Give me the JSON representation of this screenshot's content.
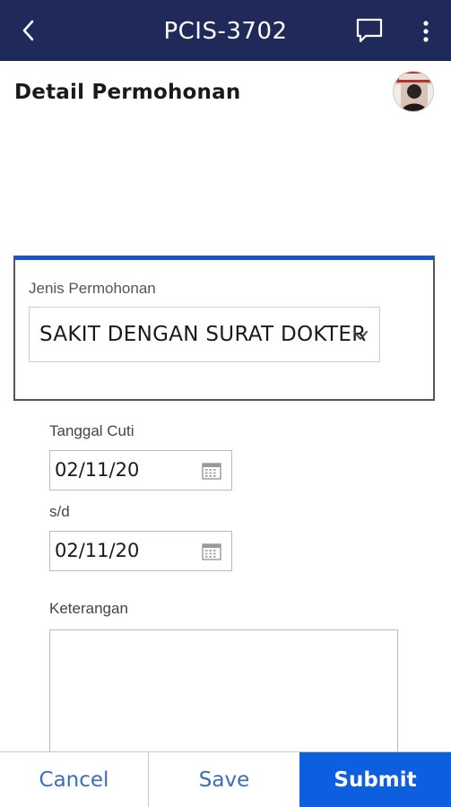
{
  "header": {
    "title": "PCIS-3702",
    "back_icon": "chevron-left-icon",
    "chat_icon": "chat-bubble-icon",
    "more_icon": "more-vertical-icon",
    "background": "#1f2a5a"
  },
  "page": {
    "title": "Detail Permohonan"
  },
  "form": {
    "request_type": {
      "label": "Jenis Permohonan",
      "value": "SAKIT DENGAN SURAT DOKTER"
    },
    "leave_date": {
      "label": "Tanggal Cuti",
      "value": "02/11/20"
    },
    "until_date": {
      "label": "s/d",
      "value": "02/11/20"
    },
    "notes": {
      "label": "Keterangan",
      "value": ""
    }
  },
  "actions": {
    "cancel": "Cancel",
    "save": "Save",
    "submit": "Submit",
    "accent": "#0d5fe0"
  }
}
